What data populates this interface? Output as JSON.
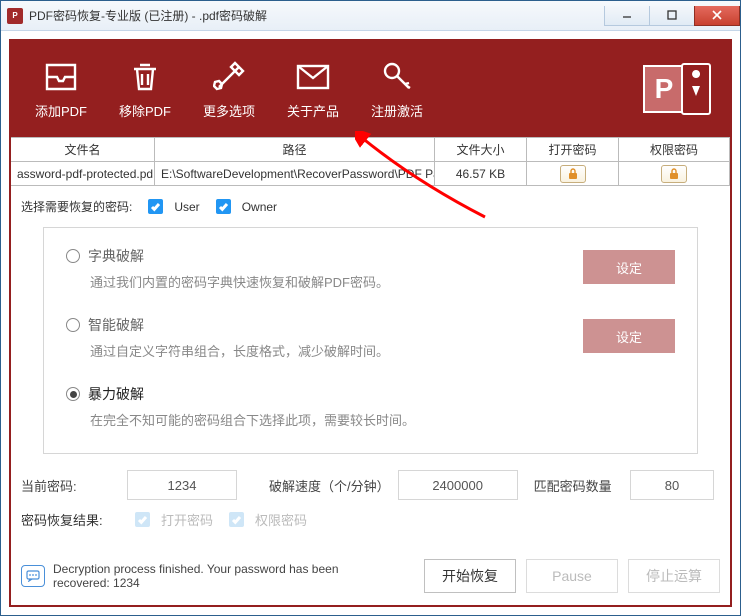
{
  "window": {
    "title": "PDF密码恢复-专业版 (已注册) - .pdf密码破解"
  },
  "toolbar": {
    "items": [
      {
        "label": "添加PDF"
      },
      {
        "label": "移除PDF"
      },
      {
        "label": "更多选项"
      },
      {
        "label": "关于产品"
      },
      {
        "label": "注册激活"
      }
    ]
  },
  "table": {
    "headers": {
      "filename": "文件名",
      "path": "路径",
      "size": "文件大小",
      "open_pwd": "打开密码",
      "perm_pwd": "权限密码"
    },
    "row": {
      "filename": "assword-pdf-protected.pd",
      "path": "E:\\SoftwareDevelopment\\RecoverPassword\\PDF Pass",
      "size": "46.57 KB"
    }
  },
  "checkline": {
    "label": "选择需要恢复的密码:",
    "user": "User",
    "owner": "Owner"
  },
  "methods": {
    "dict": {
      "title": "字典破解",
      "desc": "通过我们内置的密码字典快速恢复和破解PDF密码。"
    },
    "smart": {
      "title": "智能破解",
      "desc": "通过自定义字符串组合，长度格式，减少破解时间。"
    },
    "brute": {
      "title": "暴力破解",
      "desc": "在完全不知可能的密码组合下选择此项，需要较长时间。"
    },
    "set_label": "设定"
  },
  "stats": {
    "current_label": "当前密码:",
    "current_value": "1234",
    "speed_label": "破解速度（个/分钟）",
    "speed_value": "2400000",
    "matched_label": "匹配密码数量",
    "matched_value": "80"
  },
  "results": {
    "label": "密码恢复结果:",
    "open_pwd": "打开密码",
    "perm_pwd": "权限密码"
  },
  "footer": {
    "status": "Decryption process finished. Your password has been recovered: 1234",
    "start": "开始恢复",
    "pause": "Pause",
    "stop": "停止运算"
  }
}
